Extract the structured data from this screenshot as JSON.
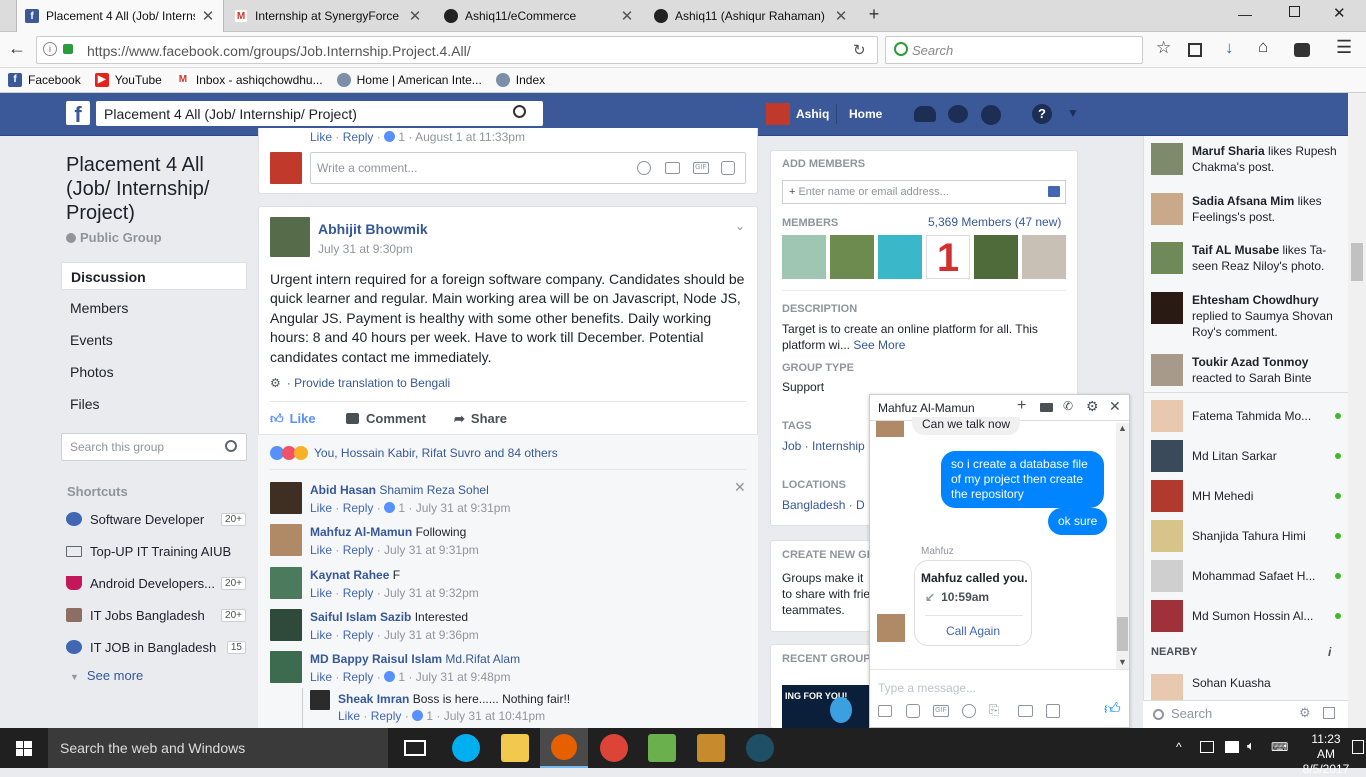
{
  "browser": {
    "tabs": [
      {
        "title": "Placement 4 All (Job/ Interns",
        "icon": "facebook-icon",
        "active": true
      },
      {
        "title": "Internship at SynergyForce -",
        "icon": "gmail-icon",
        "active": false
      },
      {
        "title": "Ashiq11/eCommerce",
        "icon": "github-icon",
        "active": false
      },
      {
        "title": "Ashiq11 (Ashiqur Rahaman)",
        "icon": "github-icon",
        "active": false
      }
    ],
    "new_tab": "+",
    "url": "https://www.facebook.com/groups/Job.Internship.Project.4.All/",
    "search_placeholder": "Search",
    "bookmarks": [
      {
        "label": "Facebook",
        "icon": "facebook-icon"
      },
      {
        "label": "YouTube",
        "icon": "youtube-icon"
      },
      {
        "label": "Inbox - ashiqchowdhu...",
        "icon": "gmail-icon"
      },
      {
        "label": "Home | American Inte...",
        "icon": "globe-icon"
      },
      {
        "label": "Index",
        "icon": "globe-icon"
      }
    ]
  },
  "fb": {
    "search_value": "Placement 4 All (Job/ Internship/ Project)",
    "user_name": "Ashiq",
    "home": "Home"
  },
  "group": {
    "title": "Placement 4 All (Job/ Internship/ Project)",
    "privacy": "Public Group",
    "nav": [
      "Discussion",
      "Members",
      "Events",
      "Photos",
      "Files"
    ],
    "search_placeholder": "Search this group",
    "shortcuts_label": "Shortcuts",
    "shortcuts": [
      {
        "label": "Software Developer",
        "count": "20+"
      },
      {
        "label": "Top-UP IT Training AIUB",
        "count": ""
      },
      {
        "label": "Android Developers...",
        "count": "20+"
      },
      {
        "label": "IT Jobs Bangladesh",
        "count": "20+"
      },
      {
        "label": "IT JOB in Bangladesh",
        "count": "15"
      }
    ],
    "see_more": "See more"
  },
  "feed": {
    "top_meta": {
      "like": "Like",
      "reply": "Reply",
      "count": "1",
      "time": "August 1 at 11:33pm"
    },
    "write_comment": "Write a comment...",
    "post": {
      "author": "Abhijit Bhowmik",
      "time": "July 31 at 9:30pm",
      "text": "Urgent intern required for a foreign software company. Candidates should be quick learner and regular. Main working area will be on Javascript, Node JS, Angular JS. Payment is healthy with some other benefits. Daily working hours: 8 and 40 hours per week. Have to work till December. Potential candidates contact me immediately.",
      "translate": "Provide translation to Bengali",
      "actions": [
        "Like",
        "Comment",
        "Share"
      ],
      "reactions": "You, Hossain Kabir, Rifat Suvro and 84 others"
    },
    "comments": [
      {
        "name": "Abid Hasan",
        "text": "Shamim Reza Sohel",
        "text_is_link": true,
        "like": "Like",
        "reply": "Reply",
        "count": "1",
        "time": "July 31 at 9:31pm"
      },
      {
        "name": "Mahfuz Al-Mamun",
        "text": "Following",
        "text_is_link": false,
        "like": "Like",
        "reply": "Reply",
        "count": "",
        "time": "July 31 at 9:31pm"
      },
      {
        "name": "Kaynat Rahee",
        "text": "F",
        "text_is_link": false,
        "like": "Like",
        "reply": "Reply",
        "count": "",
        "time": "July 31 at 9:32pm"
      },
      {
        "name": "Saiful Islam Sazib",
        "text": "Interested",
        "text_is_link": false,
        "like": "Like",
        "reply": "Reply",
        "count": "",
        "time": "July 31 at 9:36pm"
      },
      {
        "name": "MD Bappy Raisul Islam",
        "text": "Md.Rifat Alam",
        "text_is_link": true,
        "like": "Like",
        "reply": "Reply",
        "count": "1",
        "time": "July 31 at 9:48pm"
      }
    ],
    "reply": {
      "name": "Sheak Imran",
      "text": "Boss is here...... Nothing fair!!",
      "like": "Like",
      "reply": "Reply",
      "count": "1",
      "time": "July 31 at 10:41pm"
    }
  },
  "right": {
    "add_members_label": "ADD MEMBERS",
    "add_members_placeholder": "Enter name or email address...",
    "members_label": "MEMBERS",
    "members_count": "5,369 Members (47 new)",
    "description_label": "DESCRIPTION",
    "description": "Target is to create an online platform for all. This platform wi...",
    "see_more": "See More",
    "group_type_label": "GROUP TYPE",
    "group_type": "Support",
    "tags_label": "TAGS",
    "tags": "Job · Internship",
    "locations_label": "LOCATIONS",
    "locations": "Bangladesh · D",
    "create_label": "CREATE NEW GR",
    "create_text": "Groups make it to share with frie teammates.",
    "recent_label": "RECENT GROUP P",
    "recent_thumb_text": "ING FOR YOU!"
  },
  "ticker": [
    {
      "name": "Maruf Sharia",
      "text": "likes Rupesh Chakma's post."
    },
    {
      "name": "Sadia Afsana Mim",
      "text": "likes Feelings's post."
    },
    {
      "name": "Taif AL Musabe",
      "text": "likes Ta-seen Reaz Niloy's photo."
    },
    {
      "name": "Ehtesham Chowdhury",
      "text": "replied to Saumya Shovan Roy's comment."
    },
    {
      "name": "Toukir Azad Tonmoy",
      "text": "reacted to Sarah Binte"
    }
  ],
  "contacts": [
    "Fatema Tahmida Mo...",
    "Md Litan Sarkar",
    "MH Mehedi",
    "Shanjida Tahura Himi",
    "Mohammad Safaet H...",
    "Md Sumon Hossin Al..."
  ],
  "nearby_label": "NEARBY",
  "nearby_contact": "Sohan Kuasha",
  "sidebar_search": "Search",
  "chat": {
    "name": "Mahfuz Al-Mamun",
    "partial": "Can we talk now",
    "messages": [
      "so i create a database file of my project then create the repository",
      "ok sure"
    ],
    "sender_label": "Mahfuz",
    "call_title": "Mahfuz called you.",
    "call_time": "10:59am",
    "call_again": "Call Again",
    "input_placeholder": "Type a message..."
  },
  "taskbar": {
    "search": "Search the web and Windows",
    "time": "11:23 AM",
    "date": "8/5/2017"
  },
  "colors": {
    "fb_blue": "#3b5998",
    "link": "#365899",
    "messenger": "#0084ff",
    "online": "#42b72a"
  }
}
